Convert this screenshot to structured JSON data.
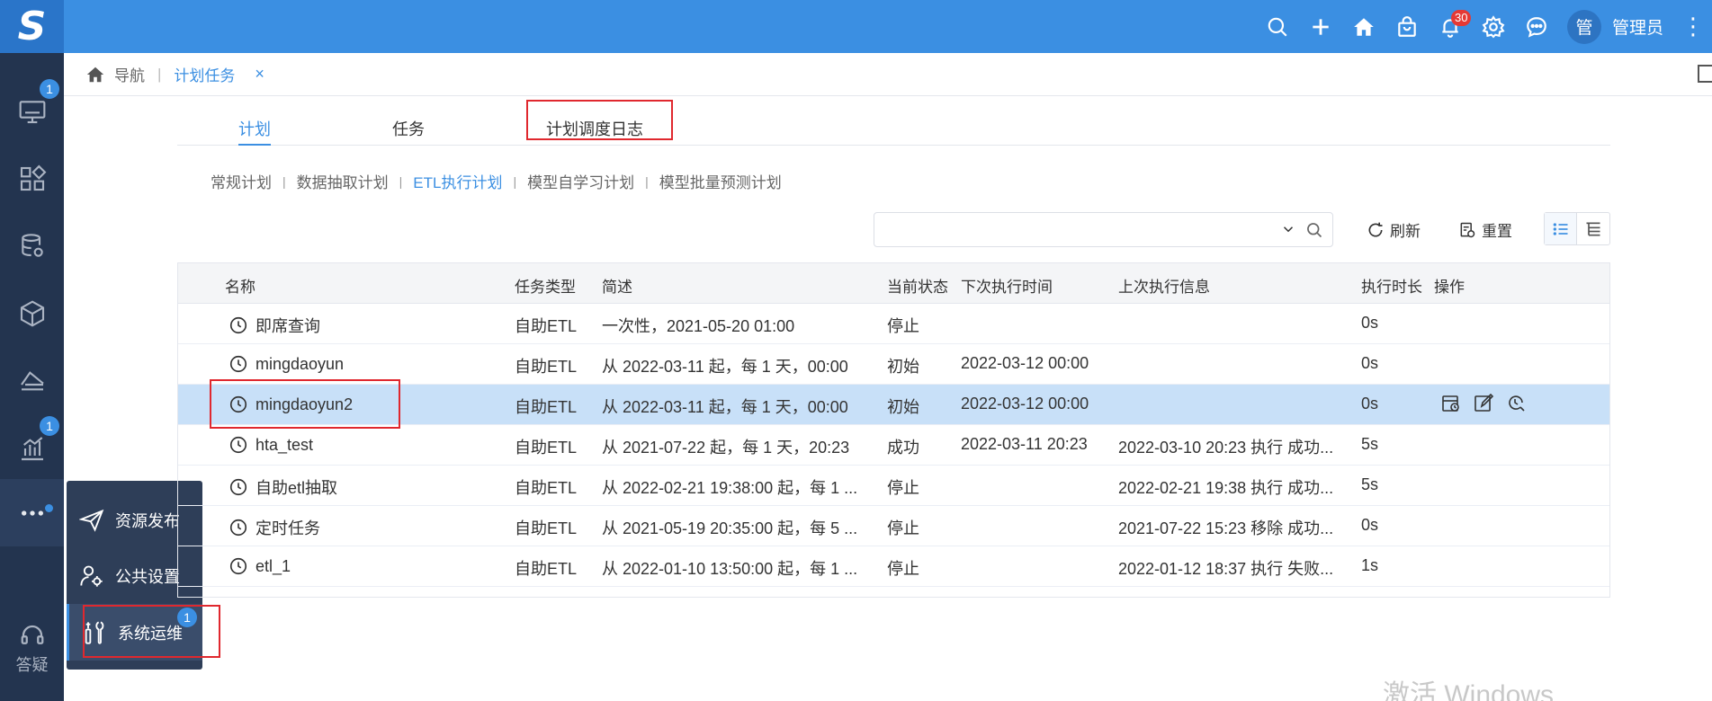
{
  "app": {
    "logo_text": "S",
    "user_avatar": "管",
    "user_name": "管理员",
    "notification_count": "30",
    "accent_color": "#3b8fe2"
  },
  "topbar_icons": [
    "search-icon",
    "plus-icon",
    "home-icon",
    "bag-icon",
    "bell-icon",
    "settings-icon",
    "chat-icon"
  ],
  "sidebar": {
    "items": [
      {
        "icon": "monitor-icon",
        "badge": "1"
      },
      {
        "icon": "dashboard-icon",
        "badge": ""
      },
      {
        "icon": "database-icon",
        "badge": ""
      },
      {
        "icon": "cube-icon",
        "badge": ""
      },
      {
        "icon": "layers-icon",
        "badge": ""
      },
      {
        "icon": "bar-chart-icon",
        "badge": "1"
      },
      {
        "icon": "more-icon",
        "badge": ""
      }
    ],
    "help_label": "答疑"
  },
  "popup_menu": {
    "items": [
      {
        "label": "资源发布",
        "icon": "send-icon"
      },
      {
        "label": "公共设置",
        "icon": "settings-people-icon"
      },
      {
        "label": "系统运维",
        "icon": "tools-icon",
        "badge": "1"
      }
    ]
  },
  "breadcrumb": {
    "nav": "导航",
    "current": "计划任务",
    "close": "×"
  },
  "tabs": [
    {
      "label": "计划"
    },
    {
      "label": "任务"
    },
    {
      "label": "计划调度日志"
    }
  ],
  "subtabs": [
    {
      "label": "常规计划"
    },
    {
      "label": "数据抽取计划"
    },
    {
      "label": "ETL执行计划"
    },
    {
      "label": "模型自学习计划"
    },
    {
      "label": "模型批量预测计划"
    }
  ],
  "toolbar": {
    "search_placeholder": "",
    "refresh_label": "刷新",
    "reset_label": "重置"
  },
  "table": {
    "columns": [
      "名称",
      "任务类型",
      "简述",
      "当前状态",
      "下次执行时间",
      "上次执行信息",
      "执行时长",
      "操作"
    ],
    "rows": [
      {
        "name": "即席查询",
        "type": "自助ETL",
        "desc": "一次性，2021-05-20 01:00",
        "status": "停止",
        "next": "",
        "last": "",
        "duration": "0s"
      },
      {
        "name": "mingdaoyun",
        "type": "自助ETL",
        "desc": "从 2022-03-11 起，每 1 天，00:00",
        "status": "初始",
        "next": "2022-03-12 00:00",
        "last": "",
        "duration": "0s"
      },
      {
        "name": "mingdaoyun2",
        "type": "自助ETL",
        "desc": "从 2022-03-11 起，每 1 天，00:00",
        "status": "初始",
        "next": "2022-03-12 00:00",
        "last": "",
        "duration": "0s"
      },
      {
        "name": "hta_test",
        "type": "自助ETL",
        "desc": "从 2021-07-22 起，每 1 天，20:23",
        "status": "成功",
        "next": "2022-03-11 20:23",
        "last": "2022-03-10 20:23 执行 成功...",
        "duration": "5s"
      },
      {
        "name": "自助etl抽取",
        "type": "自助ETL",
        "desc": "从 2022-02-21 19:38:00 起，每 1 ...",
        "status": "停止",
        "next": "",
        "last": "2022-02-21 19:38 执行 成功...",
        "duration": "5s"
      },
      {
        "name": "定时任务",
        "type": "自助ETL",
        "desc": "从 2021-05-19 20:35:00 起，每 5 ...",
        "status": "停止",
        "next": "",
        "last": "2021-07-22 15:23 移除 成功...",
        "duration": "0s"
      },
      {
        "name": "etl_1",
        "type": "自助ETL",
        "desc": "从 2022-01-10 13:50:00 起，每 1 ...",
        "status": "停止",
        "next": "",
        "last": "2022-01-12 18:37 执行 失败...",
        "duration": "1s"
      }
    ],
    "row_ops": [
      "schedule-run-icon",
      "edit-icon",
      "log-search-icon"
    ]
  },
  "watermark": "激活 Windows"
}
